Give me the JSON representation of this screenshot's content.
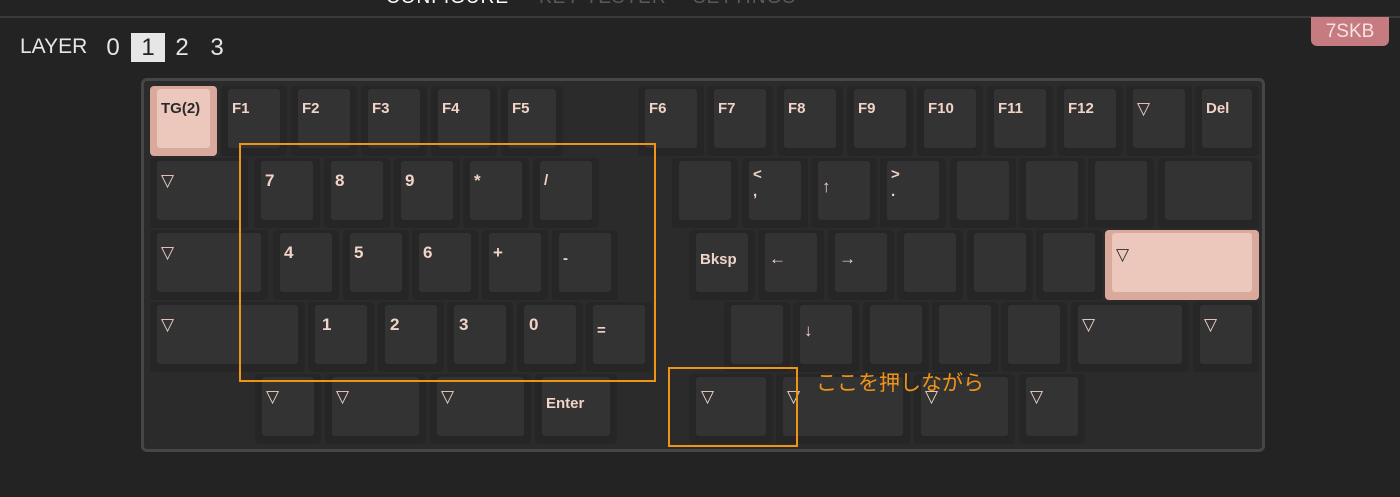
{
  "nav": {
    "tabs": [
      {
        "label": "CONFIGURE"
      },
      {
        "label": "KEY TESTER"
      },
      {
        "label": "SETTINGS"
      }
    ]
  },
  "layer": {
    "label": "LAYER",
    "numbers": [
      "0",
      "1",
      "2",
      "3"
    ],
    "selected": "1"
  },
  "badge": "7SKB",
  "annotation": "ここを押しながら",
  "colors": {
    "highlight": "#f09418",
    "badge": "#c57b7f",
    "pink_key": "#ecc7bc",
    "key_text": "#f1d3c7"
  },
  "keys": {
    "tg2": "TG(2)",
    "f1": "F1",
    "f2": "F2",
    "f3": "F3",
    "f4": "F4",
    "f5": "F5",
    "f6": "F6",
    "f7": "F7",
    "f8": "F8",
    "f9": "F9",
    "f10": "F10",
    "f11": "F11",
    "f12": "F12",
    "r1_trans": "▽",
    "del": "Del",
    "r2_trans": "▽",
    "num7": "7",
    "num8": "8",
    "num9": "9",
    "star": "*",
    "slash": "/",
    "r2_blank1": "",
    "lt_comma": "<\n,",
    "up": "↑",
    "gt_period": ">\n.",
    "r2_blank2": "",
    "r2_blank3": "",
    "r2_blank4": "",
    "r2_blank5": "",
    "r3_trans": "▽",
    "num4": "4",
    "num5": "5",
    "num6": "6",
    "plus": "+",
    "minus": "-",
    "bksp": "Bksp",
    "left": "←",
    "right": "→",
    "r3_blank1": "",
    "r3_blank2": "",
    "r3_blank3": "",
    "enter_trans": "▽",
    "r4_trans": "▽",
    "num1": "1",
    "num2": "2",
    "num3": "3",
    "num0": "0",
    "equal": "=",
    "r4_blank1": "",
    "down": "↓",
    "r4_blank2": "",
    "r4_blank3": "",
    "r4_blank4": "",
    "r4_trans2": "▽",
    "r4_trans3": "▽",
    "r5_trans1": "▽",
    "r5_trans2": "▽",
    "r5_trans3": "▽",
    "enter": "Enter",
    "r5_trans4": "▽",
    "r5_trans5": "▽",
    "r5_trans6": "▽",
    "r5_trans7": "▽"
  }
}
